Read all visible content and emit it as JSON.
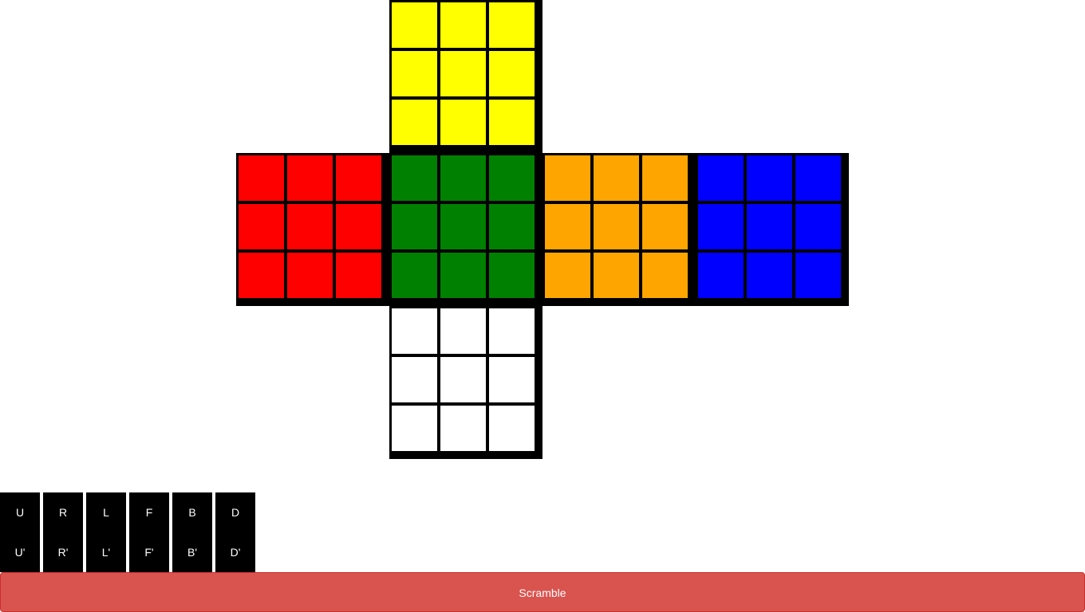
{
  "cube": {
    "faces": [
      {
        "id": "up",
        "color": "#ffff00",
        "color_name": "yellow"
      },
      {
        "id": "left",
        "color": "#ff0000",
        "color_name": "red"
      },
      {
        "id": "front",
        "color": "#008000",
        "color_name": "green"
      },
      {
        "id": "right",
        "color": "#ffa500",
        "color_name": "orange"
      },
      {
        "id": "back",
        "color": "#0000ff",
        "color_name": "blue"
      },
      {
        "id": "down",
        "color": "#ffffff",
        "color_name": "white"
      }
    ],
    "grid_color": "#000000"
  },
  "moves": [
    {
      "name": "U",
      "cw": "U",
      "ccw": "U'"
    },
    {
      "name": "R",
      "cw": "R",
      "ccw": "R'"
    },
    {
      "name": "L",
      "cw": "L",
      "ccw": "L'"
    },
    {
      "name": "F",
      "cw": "F",
      "ccw": "F'"
    },
    {
      "name": "B",
      "cw": "B",
      "ccw": "B'"
    },
    {
      "name": "D",
      "cw": "D",
      "ccw": "D'"
    }
  ],
  "scramble": {
    "label": "Scramble",
    "color": "#d9534f"
  }
}
